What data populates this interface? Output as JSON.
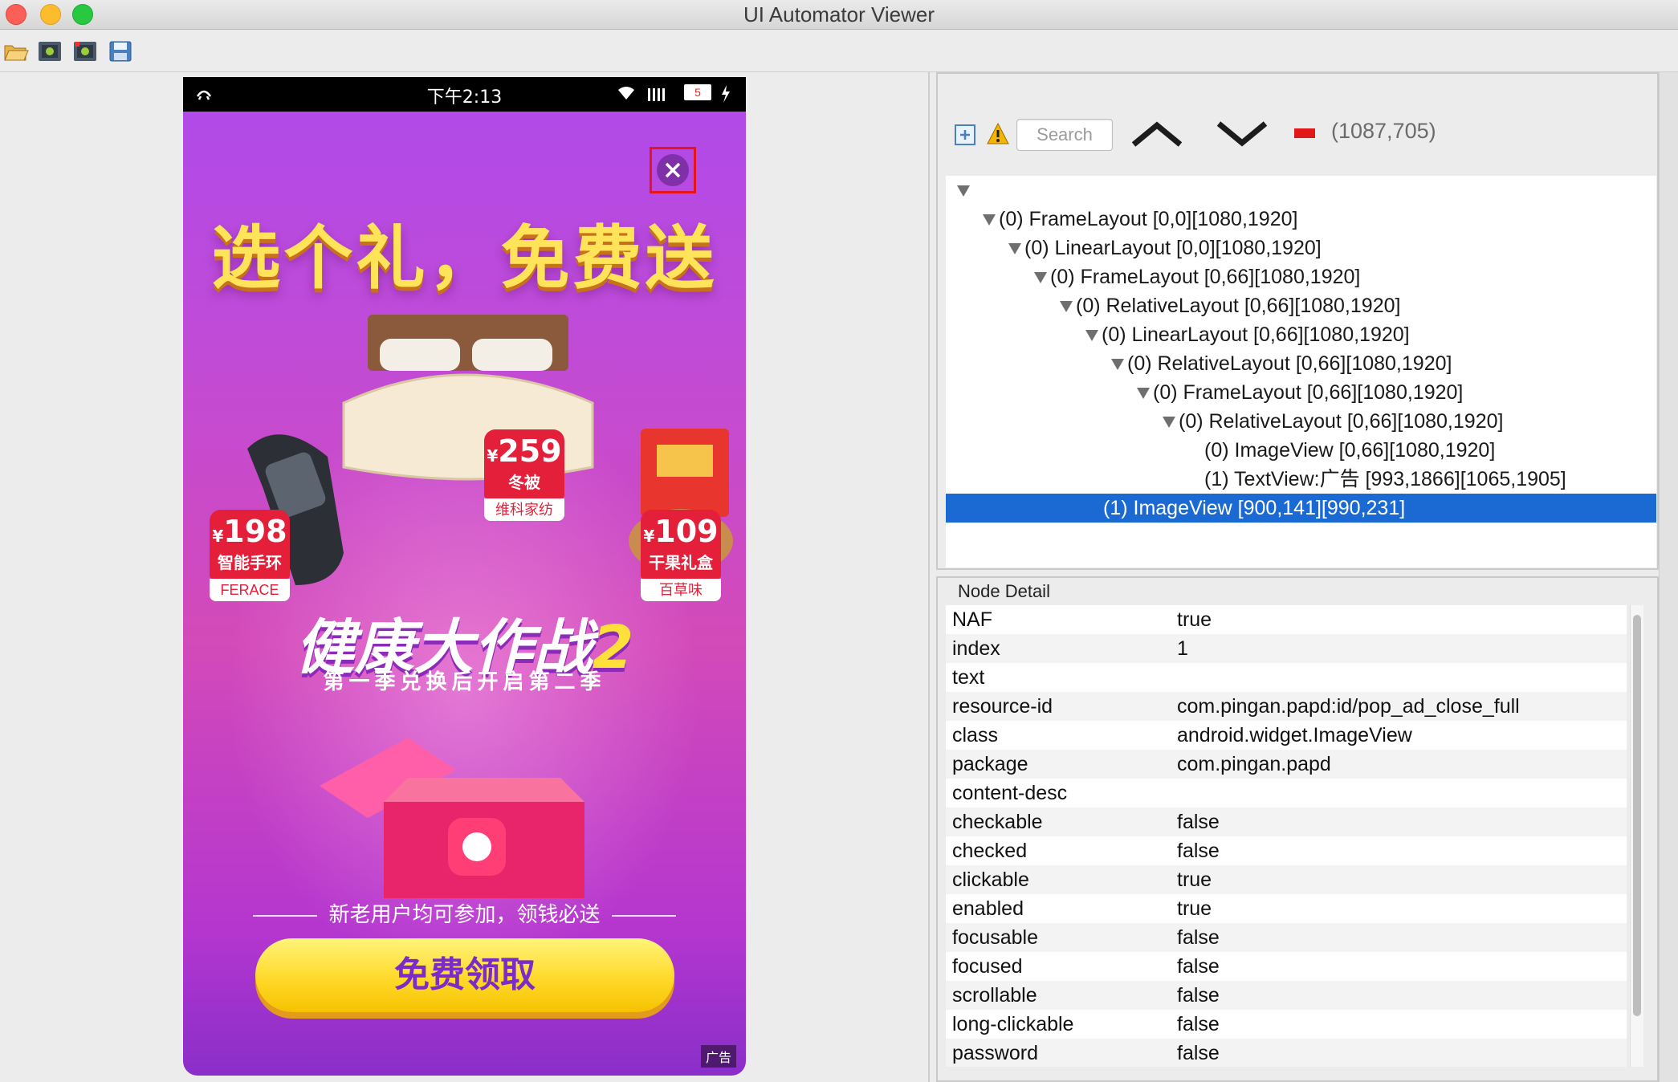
{
  "window": {
    "title": "UI Automator Viewer"
  },
  "toolbar": {
    "icons": [
      "folder-open-icon",
      "android-screenshot-icon",
      "android-compressed-icon",
      "save-icon"
    ]
  },
  "device": {
    "status_time": "下午2:13",
    "battery": "5",
    "ad": {
      "headline": "选个礼，免费送",
      "products": [
        {
          "price": "198",
          "currency": "¥",
          "name": "智能手环",
          "brand": "FERACE"
        },
        {
          "price": "259",
          "currency": "¥",
          "name": "冬被",
          "brand": "维科家纺"
        },
        {
          "price": "109",
          "currency": "¥",
          "name": "干果礼盒",
          "brand": "百草味"
        }
      ],
      "campaign_title": "健康大作战",
      "campaign_num": "2",
      "campaign_subtitle": "第一季兑换后开启第二季",
      "note": "新老用户均可参加，领钱必送",
      "cta": "免费领取",
      "ad_label": "广告"
    }
  },
  "hierarchy": {
    "search_placeholder": "Search",
    "coordinates": "(1087,705)",
    "nodes": [
      {
        "label": "(0) FrameLayout [0,0][1080,1920]"
      },
      {
        "label": "(0) LinearLayout [0,0][1080,1920]"
      },
      {
        "label": "(0) FrameLayout [0,66][1080,1920]"
      },
      {
        "label": "(0) RelativeLayout [0,66][1080,1920]"
      },
      {
        "label": "(0) LinearLayout [0,66][1080,1920]"
      },
      {
        "label": "(0) RelativeLayout [0,66][1080,1920]"
      },
      {
        "label": "(0) FrameLayout [0,66][1080,1920]"
      },
      {
        "label": "(0) RelativeLayout [0,66][1080,1920]"
      },
      {
        "label": "(0) ImageView [0,66][1080,1920]"
      },
      {
        "label": "(1) TextView:广告 [993,1866][1065,1905]"
      },
      {
        "label": "(1) ImageView [900,141][990,231]",
        "selected": true
      }
    ]
  },
  "node_detail": {
    "title": "Node Detail",
    "rows": [
      {
        "key": "NAF",
        "value": "true"
      },
      {
        "key": "index",
        "value": "1"
      },
      {
        "key": "text",
        "value": ""
      },
      {
        "key": "resource-id",
        "value": "com.pingan.papd:id/pop_ad_close_full"
      },
      {
        "key": "class",
        "value": "android.widget.ImageView"
      },
      {
        "key": "package",
        "value": "com.pingan.papd"
      },
      {
        "key": "content-desc",
        "value": ""
      },
      {
        "key": "checkable",
        "value": "false"
      },
      {
        "key": "checked",
        "value": "false"
      },
      {
        "key": "clickable",
        "value": "true"
      },
      {
        "key": "enabled",
        "value": "true"
      },
      {
        "key": "focusable",
        "value": "false"
      },
      {
        "key": "focused",
        "value": "false"
      },
      {
        "key": "scrollable",
        "value": "false"
      },
      {
        "key": "long-clickable",
        "value": "false"
      },
      {
        "key": "password",
        "value": "false"
      }
    ]
  },
  "colors": {
    "selection": "#1b6ad4",
    "ad_purple": "#b14ae8",
    "tag_red": "#e41f3a",
    "headline_yellow": "#ffe45a"
  }
}
